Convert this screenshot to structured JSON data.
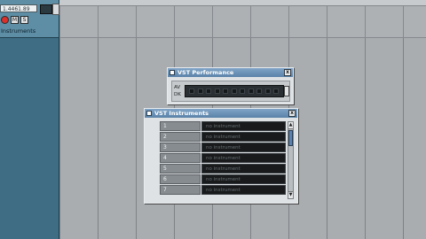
{
  "track": {
    "top_field": "1.4461.89",
    "name": "Instruments",
    "buttons": {
      "record": "",
      "mute": "M",
      "solo": "S"
    }
  },
  "vst_performance": {
    "title": "VST Performance",
    "close": "x",
    "meter_labels": [
      "AV",
      "DK"
    ]
  },
  "vst_instruments": {
    "title": "VST Instruments",
    "close": "x",
    "slots": [
      {
        "number": "1",
        "value": "no instrument"
      },
      {
        "number": "2",
        "value": "no instrument"
      },
      {
        "number": "3",
        "value": "no instrument"
      },
      {
        "number": "4",
        "value": "no instrument"
      },
      {
        "number": "5",
        "value": "no instrument"
      },
      {
        "number": "6",
        "value": "no instrument"
      },
      {
        "number": "7",
        "value": "no instrument"
      }
    ]
  },
  "colors": {
    "accent_titlebar": "#5a82a8",
    "panel_blue": "#3e6d84",
    "record_red": "#d9302c"
  }
}
